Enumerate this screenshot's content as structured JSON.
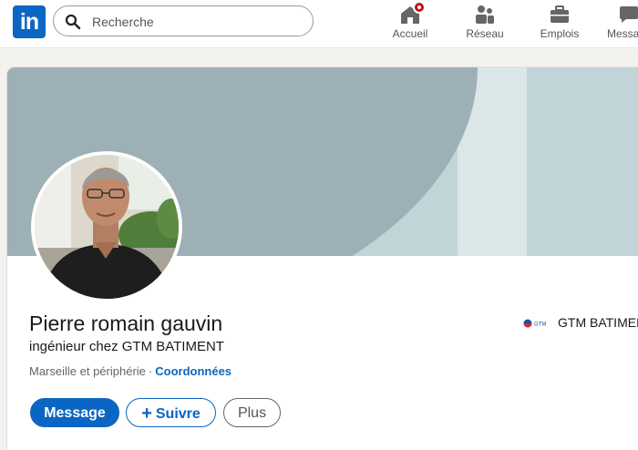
{
  "topbar": {
    "logo_text": "in",
    "search": {
      "placeholder": "Recherche",
      "value": ""
    },
    "nav": [
      {
        "icon": "home-icon",
        "label": "Accueil",
        "has_notification": true
      },
      {
        "icon": "network-icon",
        "label": "Réseau"
      },
      {
        "icon": "briefcase-icon",
        "label": "Emplois"
      },
      {
        "icon": "messaging-icon",
        "label": "Messa"
      }
    ]
  },
  "profile": {
    "name": "Pierre romain gauvin",
    "headline": "ingénieur chez GTM BATIMENT",
    "location": "Marseille et périphérie",
    "separator": "·",
    "contact_link": "Coordonnées",
    "current_company": {
      "name": "GTM BATIMEN",
      "logo_text": "GTM"
    },
    "actions": {
      "message": "Message",
      "follow": "Suivre",
      "follow_icon": "+",
      "more": "Plus"
    }
  },
  "colors": {
    "brand": "#0a66c2",
    "banner_dark": "#9db0b5",
    "banner_light": "#c1d5d9",
    "notification": "#cc1016"
  }
}
